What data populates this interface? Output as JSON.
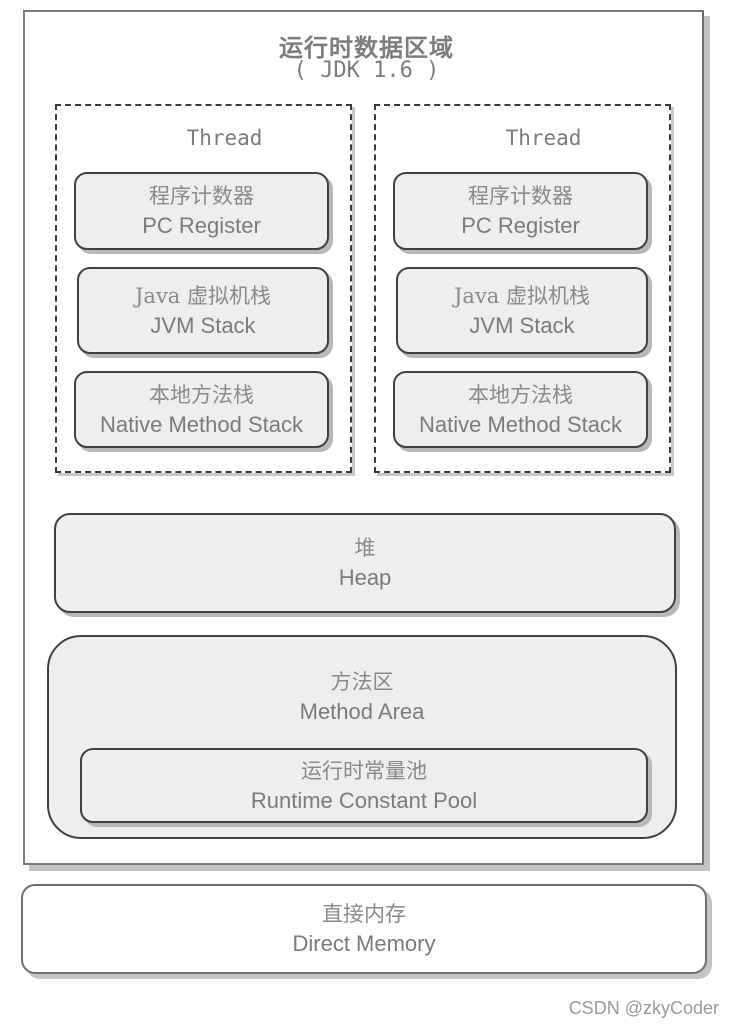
{
  "diagram": {
    "title": "运行时数据区域",
    "version": "( JDK 1.6 )",
    "threads": [
      {
        "label": "Thread",
        "areas": [
          {
            "cn": "程序计数器",
            "en": "PC Register"
          },
          {
            "cn": "Java 虚拟机栈",
            "en": "JVM Stack"
          },
          {
            "cn": "本地方法栈",
            "en": "Native Method Stack"
          }
        ]
      },
      {
        "label": "Thread",
        "areas": [
          {
            "cn": "程序计数器",
            "en": "PC Register"
          },
          {
            "cn": "Java 虚拟机栈",
            "en": "JVM Stack"
          },
          {
            "cn": "本地方法栈",
            "en": "Native Method Stack"
          }
        ]
      }
    ],
    "heap": {
      "cn": "堆",
      "en": "Heap"
    },
    "method_area": {
      "cn": "方法区",
      "en": "Method Area",
      "runtime_constant_pool": {
        "cn": "运行时常量池",
        "en": "Runtime Constant Pool"
      }
    },
    "direct_memory": {
      "cn": "直接内存",
      "en": "Direct Memory"
    }
  },
  "watermark": "CSDN @zkyCoder"
}
